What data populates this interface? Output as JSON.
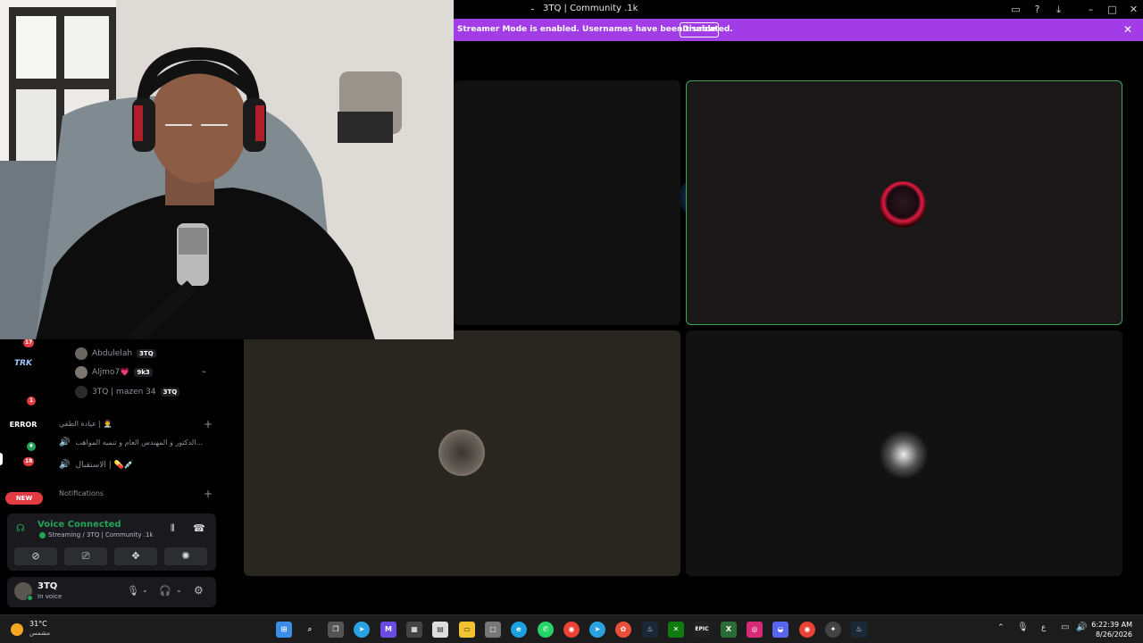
{
  "window": {
    "title": "3TQ | Community .1k"
  },
  "banner": {
    "message": "Streamer Mode is enabled. Usernames have been truncated.",
    "disable_label": "Disable"
  },
  "rail": {
    "servers": [
      "TRK",
      "ERROR"
    ],
    "badges": [
      "17",
      "1",
      "18"
    ],
    "new_label": "NEW"
  },
  "sidebar": {
    "members": [
      {
        "name": "Abdulelah",
        "tag": "3TQ"
      },
      {
        "name": "Aljmo7💗",
        "tag": "9k3"
      },
      {
        "name": "3TQ | mazen 34",
        "tag": "3TQ"
      }
    ],
    "category": "عيادة الطقي | 👨‍⚕️",
    "channels": [
      "الدكتور و المهندس العام و تنميه المواهب...",
      "الاستقبال | 💊💉"
    ],
    "notifications": "Notifications"
  },
  "voice": {
    "title": "Voice Connected",
    "subtitle": "Streaming / 3TQ | Community .1k"
  },
  "user": {
    "name": "3TQ",
    "status": "In voice"
  },
  "taskbar": {
    "temperature": "31°C",
    "weather": "مشمس",
    "time": "6:22:39 AM",
    "date": "8/26/2026"
  },
  "colors": {
    "banner": "#a13ce6",
    "voice_green": "#23a559",
    "active_border": "#3ba55d"
  }
}
